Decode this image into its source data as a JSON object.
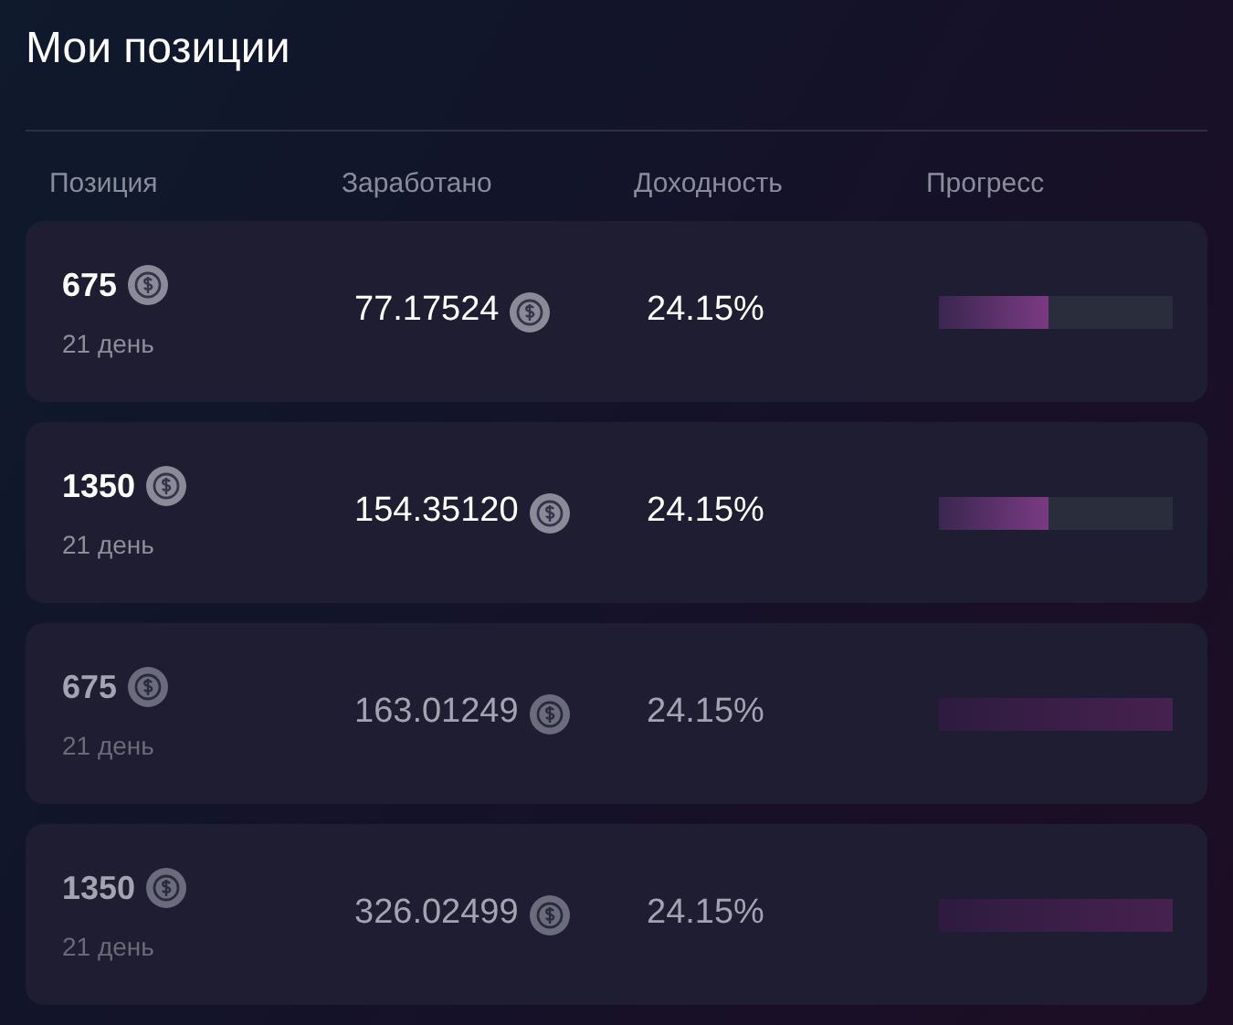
{
  "title": "Мои позиции",
  "columns": [
    "Позиция",
    "Заработано",
    "Доходность",
    "Прогресс"
  ],
  "positions": [
    {
      "amount": "675",
      "term": "21 день",
      "earned": "77.17524",
      "yield": "24.15%",
      "level": 0.47,
      "dimmed": false
    },
    {
      "amount": "1350",
      "term": "21 день",
      "earned": "154.35120",
      "yield": "24.15%",
      "level": 0.47,
      "dimmed": false
    },
    {
      "amount": "675",
      "term": "21 день",
      "earned": "163.01249",
      "yield": "24.15%",
      "level": 1,
      "dimmed": true
    },
    {
      "amount": "1350",
      "term": "21 день",
      "earned": "326.02499",
      "yield": "24.15%",
      "level": 1,
      "dimmed": true
    }
  ]
}
